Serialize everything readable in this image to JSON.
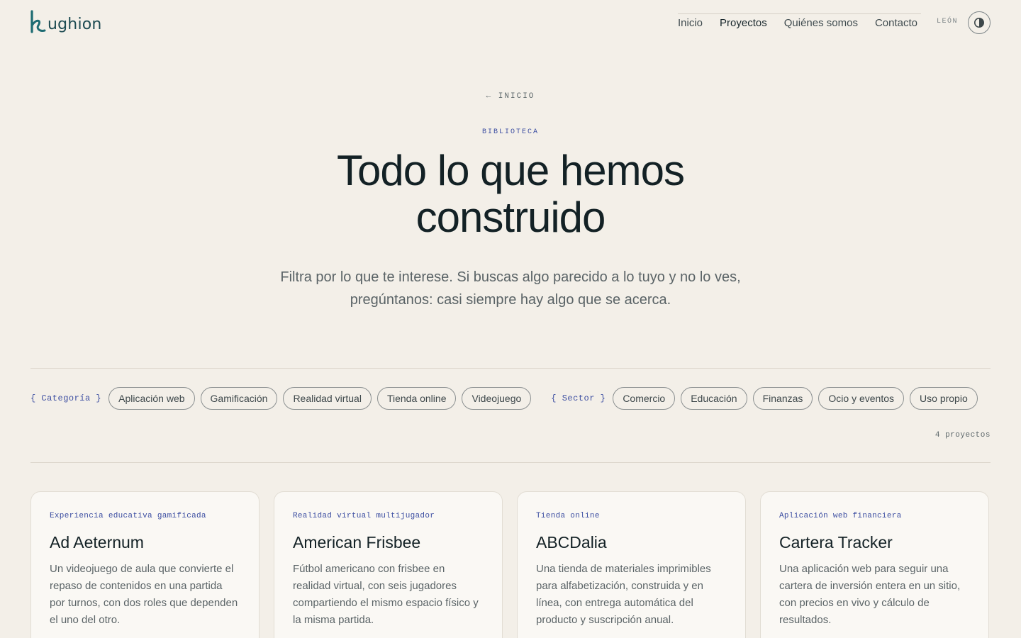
{
  "header": {
    "logo_text": "ughion",
    "nav": [
      {
        "label": "Inicio",
        "active": false
      },
      {
        "label": "Proyectos",
        "active": true
      },
      {
        "label": "Quiénes somos",
        "active": false
      },
      {
        "label": "Contacto",
        "active": false
      }
    ],
    "lang": "LEÓN",
    "theme_icon": "contrast-icon"
  },
  "hero": {
    "back_link": "← INICIO",
    "eyebrow": "BIBLIOTECA",
    "title_line1": "Todo lo que hemos",
    "title_line2": "construido",
    "lead_line1": "Filtra por lo que te interese. Si buscas algo parecido a lo tuyo y no lo ves,",
    "lead_line2": "pregúntanos: casi siempre hay algo que se acerca."
  },
  "filters": {
    "category_label": "{ Categoría }",
    "categories": [
      "Aplicación web",
      "Gamificación",
      "Realidad virtual",
      "Tienda online",
      "Videojuego"
    ],
    "sector_label": "{ Sector }",
    "sectors": [
      "Comercio",
      "Educación",
      "Finanzas",
      "Ocio y eventos",
      "Uso propio"
    ],
    "count": "4 proyectos"
  },
  "projects": [
    {
      "tag": "Experiencia educativa gamificada",
      "title": "Ad Aeternum",
      "description": "Un videojuego de aula que convierte el repaso de contenidos en una partida por turnos, con dos roles que dependen el uno del otro."
    },
    {
      "tag": "Realidad virtual multijugador",
      "title": "American Frisbee",
      "description": "Fútbol americano con frisbee en realidad virtual, con seis jugadores compartiendo el mismo espacio físico y la misma partida."
    },
    {
      "tag": "Tienda online",
      "title": "ABCDalia",
      "description": "Una tienda de materiales imprimibles para alfabetización, construida y en línea, con entrega automática del producto y suscripción anual."
    },
    {
      "tag": "Aplicación web financiera",
      "title": "Cartera Tracker",
      "description": "Una aplicación web para seguir una cartera de inversión entera en un sitio, con precios en vivo y cálculo de resultados."
    }
  ],
  "colors": {
    "background": "#f3efe8",
    "accent_blue": "#3b4da1",
    "brand_teal": "#1d6b72",
    "text_dark": "#132125"
  }
}
